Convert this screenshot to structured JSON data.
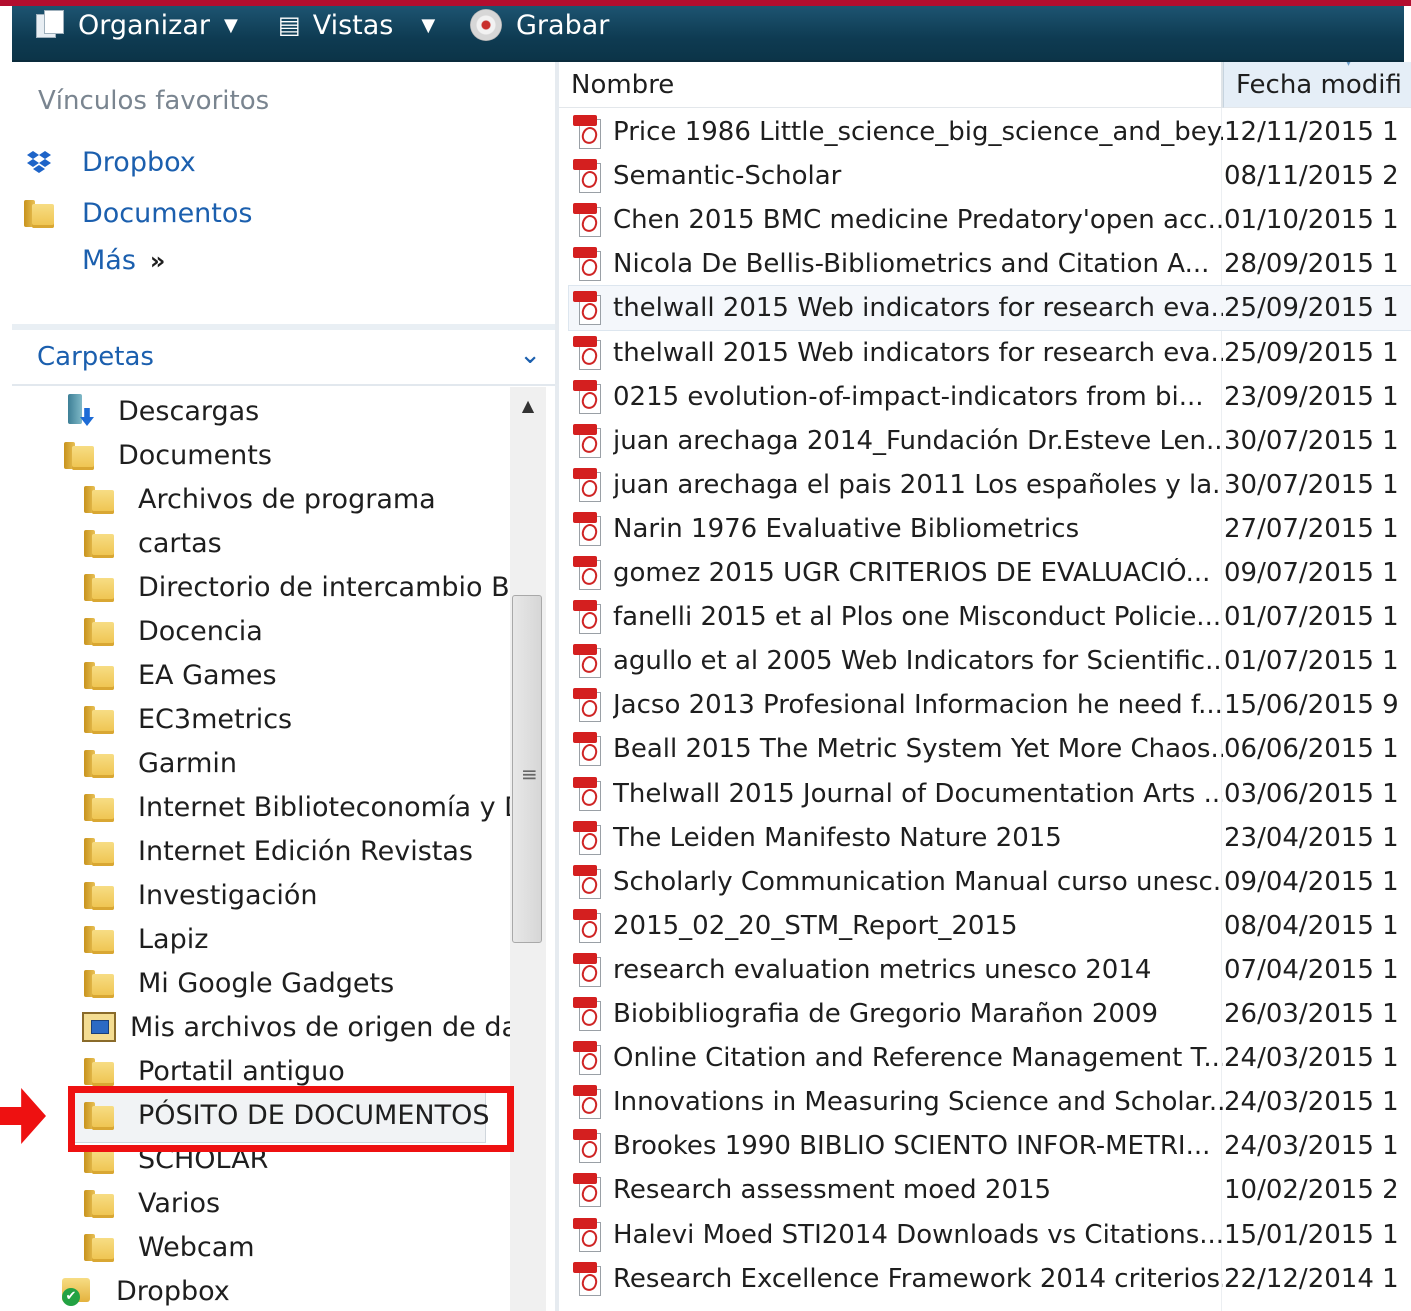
{
  "toolbar": {
    "organizar": "Organizar",
    "vistas": "Vistas",
    "grabar": "Grabar"
  },
  "nav": {
    "favorites_title": "Vínculos favoritos",
    "favorites": [
      "Dropbox",
      "Documentos"
    ],
    "more_label": "Más",
    "folders_title": "Carpetas",
    "tree": [
      {
        "label": "Descargas",
        "icon": "download-folder-icon"
      },
      {
        "label": "Documents",
        "icon": "folder-icon"
      },
      {
        "label": "Archivos de programa",
        "icon": "folder-icon"
      },
      {
        "label": "cartas",
        "icon": "folder-icon"
      },
      {
        "label": "Directorio de intercambio Blu",
        "icon": "folder-icon"
      },
      {
        "label": "Docencia",
        "icon": "folder-icon"
      },
      {
        "label": "EA Games",
        "icon": "folder-icon"
      },
      {
        "label": "EC3metrics",
        "icon": "folder-icon"
      },
      {
        "label": "Garmin",
        "icon": "folder-icon"
      },
      {
        "label": "Internet Biblioteconomía y Dc",
        "icon": "folder-icon"
      },
      {
        "label": "Internet Edición Revistas",
        "icon": "folder-icon"
      },
      {
        "label": "Investigación",
        "icon": "folder-icon"
      },
      {
        "label": "Lapiz",
        "icon": "folder-icon"
      },
      {
        "label": "Mi Google Gadgets",
        "icon": "folder-icon"
      },
      {
        "label": "Mis archivos de origen de dat",
        "icon": "data-sources-folder-icon"
      },
      {
        "label": "Portatil antiguo",
        "icon": "folder-icon"
      },
      {
        "label": "PÓSITO DE DOCUMENTOS",
        "icon": "folder-icon"
      },
      {
        "label": "SCHOLAR",
        "icon": "folder-icon"
      },
      {
        "label": "Varios",
        "icon": "folder-icon"
      },
      {
        "label": "Webcam",
        "icon": "folder-icon"
      },
      {
        "label": "Dropbox",
        "icon": "dropbox-synced-folder-icon"
      }
    ],
    "selected_index": 16
  },
  "files": {
    "columns": {
      "name": "Nombre",
      "date": "Fecha modifi"
    },
    "rows": [
      {
        "name": "Price 1986 Little_science_big_science_and_bey...",
        "date": "12/11/2015 1"
      },
      {
        "name": "Semantic-Scholar",
        "date": "08/11/2015 2"
      },
      {
        "name": "Chen 2015 BMC medicine Predatory'open acc...",
        "date": "01/10/2015 1"
      },
      {
        "name": "Nicola De Bellis-Bibliometrics and Citation A...",
        "date": "28/09/2015 1"
      },
      {
        "name": "thelwall 2015 Web indicators for research eva...",
        "date": "25/09/2015 1"
      },
      {
        "name": "thelwall 2015 Web indicators for research eva...",
        "date": "25/09/2015 1"
      },
      {
        "name": "0215 evolution-of-impact-indicators from bi...",
        "date": "23/09/2015 1"
      },
      {
        "name": "juan arechaga 2014_Fundación Dr.Esteve Len...",
        "date": "30/07/2015 1"
      },
      {
        "name": "juan arechaga el pais 2011 Los españoles y la...",
        "date": "30/07/2015 1"
      },
      {
        "name": "Narin 1976 Evaluative Bibliometrics",
        "date": "27/07/2015 1"
      },
      {
        "name": "gomez 2015 UGR CRITERIOS DE EVALUACIÓ...",
        "date": "09/07/2015 1"
      },
      {
        "name": "fanelli 2015 et al Plos one Misconduct Policie...",
        "date": "01/07/2015 1"
      },
      {
        "name": "agullo et al 2005 Web Indicators for Scientific...",
        "date": "01/07/2015 1"
      },
      {
        "name": "Jacso 2013 Profesional Informacion he need f...",
        "date": "15/06/2015 9"
      },
      {
        "name": "Beall 2015 The Metric System Yet More Chaos...",
        "date": "06/06/2015 1"
      },
      {
        "name": "Thelwall 2015 Journal of Documentation Arts ...",
        "date": "03/06/2015 1"
      },
      {
        "name": "The Leiden Manifesto Nature 2015",
        "date": "23/04/2015 1"
      },
      {
        "name": "Scholarly Communication Manual curso unesc...",
        "date": "09/04/2015 1"
      },
      {
        "name": "2015_02_20_STM_Report_2015",
        "date": "08/04/2015 1"
      },
      {
        "name": "research evaluation metrics unesco 2014",
        "date": "07/04/2015 1"
      },
      {
        "name": "Biobibliografia de Gregorio Marañon 2009",
        "date": "26/03/2015 1"
      },
      {
        "name": "Online Citation and Reference Management T...",
        "date": "24/03/2015 1"
      },
      {
        "name": "Innovations in Measuring Science and Scholar...",
        "date": "24/03/2015 1"
      },
      {
        "name": "Brookes 1990 BIBLIO SCIENTO  INFOR-METRI...",
        "date": "24/03/2015 1"
      },
      {
        "name": "Research assessment moed 2015",
        "date": "10/02/2015 2"
      },
      {
        "name": "Halevi Moed STI2014 Downloads vs Citations...",
        "date": "15/01/2015 1"
      },
      {
        "name": "Research Excellence Framework 2014 criterios...",
        "date": "22/12/2014 1"
      }
    ],
    "highlighted_index": 4
  },
  "colors": {
    "accent_red": "#b30e2f",
    "toolbar_blue": "#0e3b52",
    "link_blue": "#1b5fae",
    "annotation_red": "#ee1111"
  }
}
